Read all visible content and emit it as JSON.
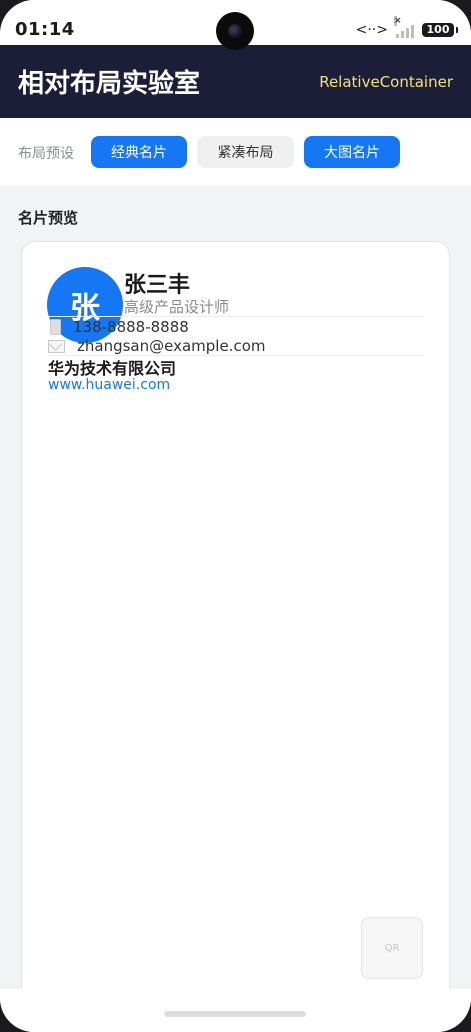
{
  "status_bar": {
    "time": "01:14",
    "battery": "100",
    "network_icon": "data-transfer-icon",
    "signal_icon": "signal-icon"
  },
  "header": {
    "title": "相对布局实验室",
    "subtitle": "RelativeContainer"
  },
  "presets": {
    "label": "布局预设",
    "options": [
      {
        "label": "经典名片",
        "state": "active"
      },
      {
        "label": "紧凑布局",
        "state": "inactive"
      },
      {
        "label": "大图名片",
        "state": "active"
      }
    ]
  },
  "preview": {
    "section_title": "名片预览",
    "card": {
      "avatar_text": "张",
      "name": "张三丰",
      "job_title": "高级产品设计师",
      "phone": "138-8888-8888",
      "email": "zhangsan@example.com",
      "company": "华为技术有限公司",
      "website": "www.huawei.com",
      "qr_label": "QR"
    }
  },
  "colors": {
    "header_bg": "#1b1e36",
    "accent": "#1677f5",
    "subtitle": "#f1e27a"
  }
}
